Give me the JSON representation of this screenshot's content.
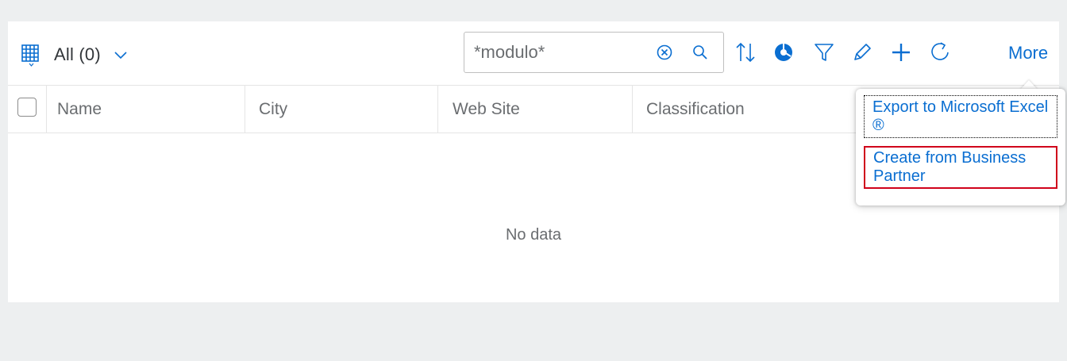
{
  "toolbar": {
    "variant_label": "All (0)",
    "search_placeholder": "*modulo*",
    "more_label": "More"
  },
  "table": {
    "columns": [
      "Name",
      "City",
      "Web Site",
      "Classification"
    ],
    "empty_text": "No data"
  },
  "more_menu": {
    "items": [
      "Export to Microsoft Excel ®",
      "Create from Business Partner"
    ]
  },
  "colors": {
    "accent": "#0a6ed1",
    "highlight_border": "#d0021b",
    "background": "#edeff0"
  },
  "icons": [
    "table-grid-icon",
    "chevron-down-icon",
    "clear-icon",
    "search-icon",
    "sort-icon",
    "pie-chart-icon",
    "filter-icon",
    "edit-icon",
    "add-icon",
    "refresh-icon"
  ]
}
